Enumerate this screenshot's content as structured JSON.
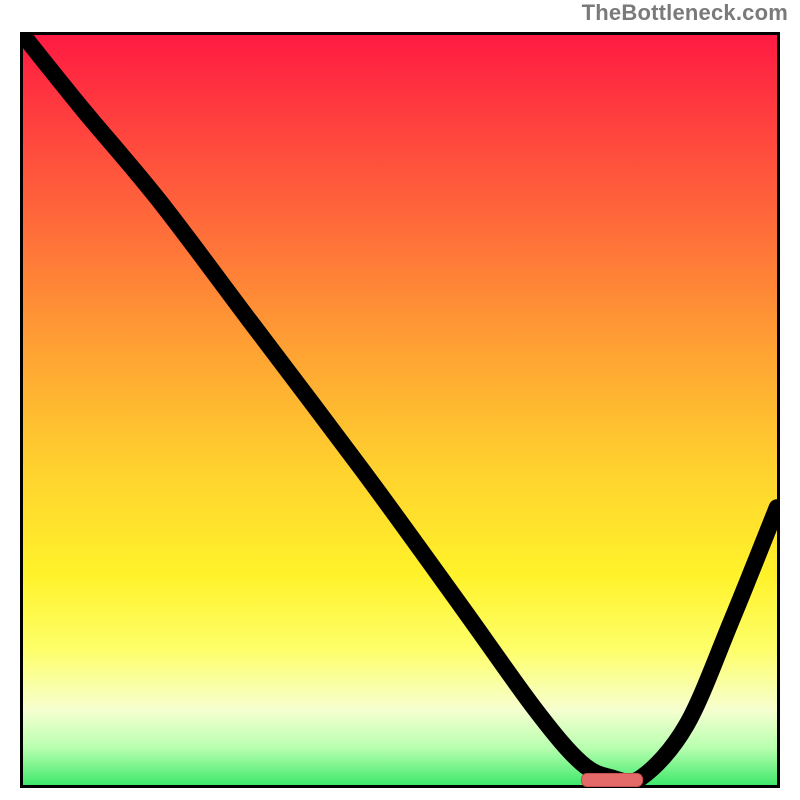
{
  "watermark": "TheBottleneck.com",
  "chart_data": {
    "type": "line",
    "title": "",
    "xlabel": "",
    "ylabel": "",
    "xlim": [
      0,
      100
    ],
    "ylim": [
      0,
      100
    ],
    "grid": false,
    "legend": false,
    "background": {
      "type": "vertical-gradient",
      "stops": [
        {
          "pos": 0,
          "color": "#ff1a42"
        },
        {
          "pos": 10,
          "color": "#ff3b3f"
        },
        {
          "pos": 25,
          "color": "#ff6a3a"
        },
        {
          "pos": 42,
          "color": "#ffa233"
        },
        {
          "pos": 58,
          "color": "#ffd22e"
        },
        {
          "pos": 72,
          "color": "#fff22a"
        },
        {
          "pos": 82,
          "color": "#feff6a"
        },
        {
          "pos": 90,
          "color": "#f6ffd0"
        },
        {
          "pos": 95,
          "color": "#b9ffb0"
        },
        {
          "pos": 100,
          "color": "#3fe86b"
        }
      ]
    },
    "series": [
      {
        "name": "bottleneck-curve",
        "x": [
          0,
          8,
          18,
          30,
          45,
          58,
          68,
          74,
          78,
          82,
          88,
          94,
          100
        ],
        "y": [
          100,
          90,
          78,
          62,
          42,
          24,
          10,
          3,
          1,
          1,
          8,
          22,
          37
        ]
      }
    ],
    "annotations": [
      {
        "name": "optimal-marker",
        "x_start": 74,
        "x_end": 82,
        "y": 0.8,
        "color": "#e46a6a"
      }
    ]
  }
}
